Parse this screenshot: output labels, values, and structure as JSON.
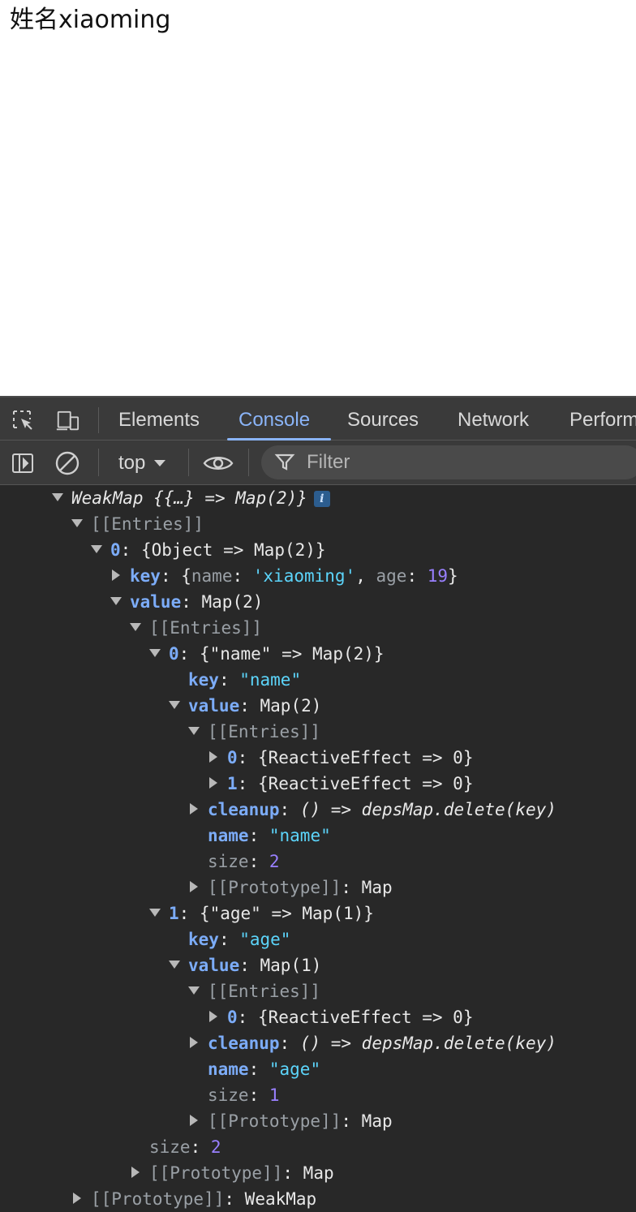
{
  "page": {
    "text": "姓名xiaoming"
  },
  "devtools": {
    "tabs": [
      {
        "label": "Elements"
      },
      {
        "label": "Console"
      },
      {
        "label": "Sources"
      },
      {
        "label": "Network"
      },
      {
        "label": "Perform"
      }
    ],
    "active_tab": "Console",
    "toolbar": {
      "context": "top",
      "filter_placeholder": "Filter"
    }
  },
  "console": {
    "root_label": "WeakMap {{…} => Map(2)}",
    "root_info": "i",
    "entries_label": "[[Entries]]",
    "e0_index": "0",
    "e0_summary": "{Object => Map(2)}",
    "e0_key_label": "key",
    "e0_key_open": "{",
    "e0_key_prop1": "name",
    "e0_key_val1": "'xiaoming'",
    "e0_key_prop2": "age",
    "e0_key_val2": "19",
    "e0_key_close": "}",
    "e0_value_label": "value",
    "e0_value_summary": "Map(2)",
    "inner_entries_label": "[[Entries]]",
    "m0_index": "0",
    "m0_summary": "{\"name\" => Map(2)}",
    "m0_key_label": "key",
    "m0_key_val": "\"name\"",
    "m0_value_label": "value",
    "m0_value_summary": "Map(2)",
    "m0_entries_label": "[[Entries]]",
    "m0_dep0_index": "0",
    "m0_dep0_summary": "{ReactiveEffect => 0}",
    "m0_dep1_index": "1",
    "m0_dep1_summary": "{ReactiveEffect => 0}",
    "m0_cleanup_label": "cleanup",
    "m0_cleanup_val": "() => depsMap.delete(key)",
    "m0_name_label": "name",
    "m0_name_val": "\"name\"",
    "m0_size_label": "size",
    "m0_size_val": "2",
    "m0_proto_label": "[[Prototype]]",
    "m0_proto_val": "Map",
    "m1_index": "1",
    "m1_summary": "{\"age\" => Map(1)}",
    "m1_key_label": "key",
    "m1_key_val": "\"age\"",
    "m1_value_label": "value",
    "m1_value_summary": "Map(1)",
    "m1_entries_label": "[[Entries]]",
    "m1_dep0_index": "0",
    "m1_dep0_summary": "{ReactiveEffect => 0}",
    "m1_cleanup_label": "cleanup",
    "m1_cleanup_val": "() => depsMap.delete(key)",
    "m1_name_label": "name",
    "m1_name_val": "\"age\"",
    "m1_size_label": "size",
    "m1_size_val": "1",
    "m1_proto_label": "[[Prototype]]",
    "m1_proto_val": "Map",
    "outer_size_label": "size",
    "outer_size_val": "2",
    "outer_proto_label": "[[Prototype]]",
    "outer_proto_val": "Map",
    "root_proto_label": "[[Prototype]]",
    "root_proto_val": "WeakMap"
  },
  "colors": {
    "panel_bg": "#282828",
    "toolbar_bg": "#3a3a3a",
    "accent": "#8ab4f8",
    "key_color": "#7cacf8",
    "string_color": "#5cd5fb",
    "number_color": "#9980ff",
    "muted_color": "#9aa0a6"
  },
  "icons": [
    "inspect-element-icon",
    "device-toggle-icon",
    "sidebar-toggle-icon",
    "clear-console-icon",
    "context-dropdown-icon",
    "live-expression-eye-icon",
    "filter-funnel-icon"
  ]
}
